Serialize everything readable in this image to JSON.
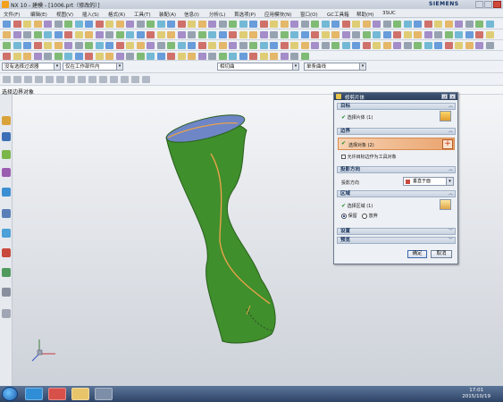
{
  "app": {
    "logo": "NX",
    "title": "NX 10 - 建模 - [1006.prt（修改的）]",
    "brand": "SIEMENS"
  },
  "menu": [
    "文件(F)",
    "编辑(E)",
    "视图(V)",
    "插入(S)",
    "格式(R)",
    "工具(T)",
    "装配(A)",
    "信息(I)",
    "分析(L)",
    "首选项(P)",
    "应用模块(N)",
    "窗口(O)",
    "GC工具箱",
    "帮助(H)",
    "3SUC"
  ],
  "selection": {
    "filter": "没有选择过滤器",
    "scope": "仅在工作部件内",
    "curve_rule": "相切曲",
    "curve_rule2": "单条曲线"
  },
  "cue": "选择边界对象",
  "dialog": {
    "title": "修剪片体",
    "target_section": "目标",
    "target_row": "选择片体 (1)",
    "boundary_section": "边界",
    "boundary_row": "选择对象 (2)",
    "boundary_check": "允许目标边作为工具对象",
    "proj_section": "投影方向",
    "proj_label": "投影方向",
    "proj_value": "垂直于面",
    "region_section": "区域",
    "region_row": "选择区域 (1)",
    "keep": "保留",
    "discard": "放弃",
    "settings": "设置",
    "preview": "预览",
    "ok": "确定",
    "cancel": "取消"
  },
  "taskbar": {
    "time": "17:01",
    "date": "2015/10/19"
  },
  "colors": {
    "part_green": "#3f8f2c",
    "accent_orange": "#e9a24a",
    "dialog_header": "#2b3f5c"
  },
  "icons": [
    "start-orb-icon",
    "skype-icon",
    "photos-icon",
    "folder-icon",
    "nx-app-icon",
    "wcs-triad-icon",
    "check-icon",
    "cross-icon",
    "gear-icon"
  ]
}
